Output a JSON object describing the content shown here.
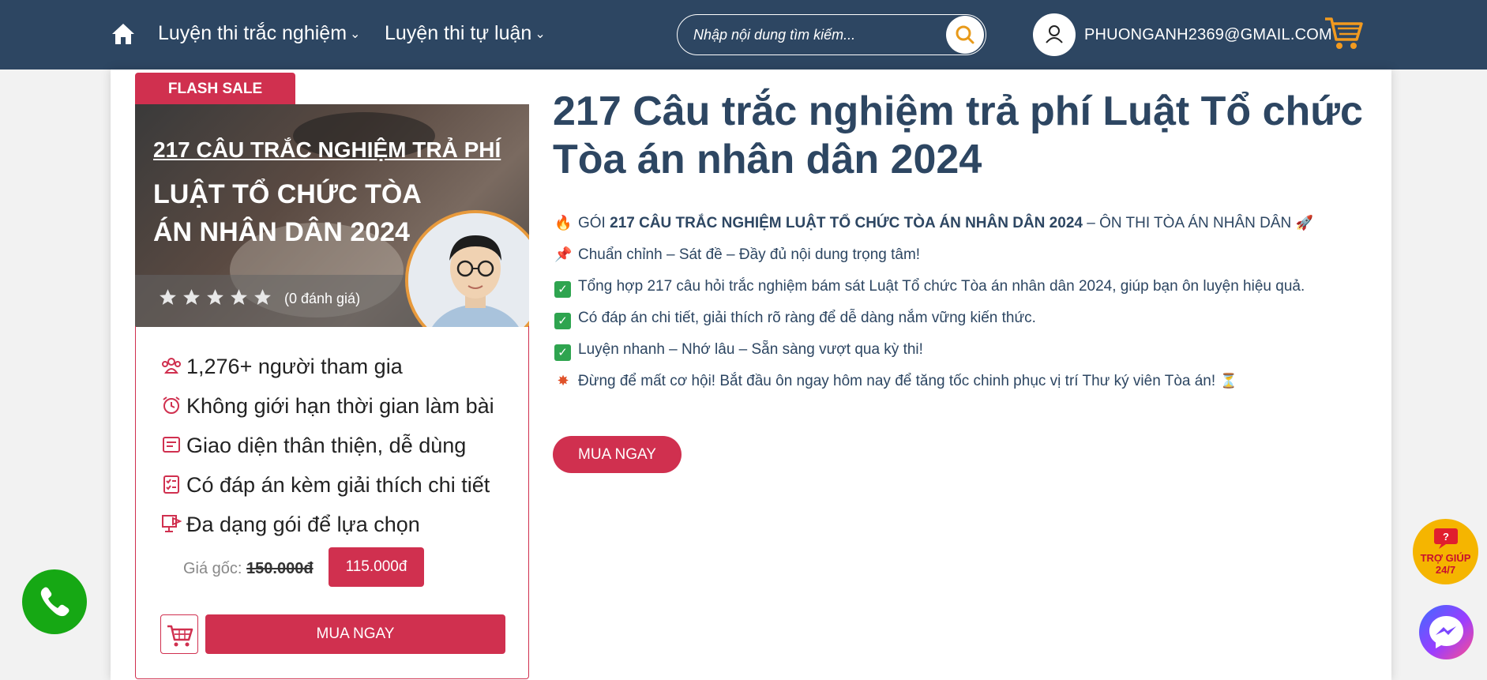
{
  "colors": {
    "header_bg": "#2d4662",
    "accent": "#d0304f",
    "title": "#2d4662",
    "check": "#2ea44f",
    "phone": "#16a814",
    "help": "#f5b500"
  },
  "header": {
    "nav": [
      {
        "label": "Luyện thi trắc nghiệm",
        "icon": "chevron-down-icon"
      },
      {
        "label": "Luyện thi tự luận",
        "icon": "chevron-down-icon"
      }
    ],
    "search_placeholder": "Nhập nội dung tìm kiếm...",
    "user_email": "PHUONGANH2369@GMAIL.COM"
  },
  "product": {
    "flash_sale": "FLASH SALE",
    "banner_title_line1": "217 CÂU TRẮC NGHIỆM TRẢ PHÍ",
    "banner_title_line2": "LUẬT TỔ CHỨC TÒA ÁN NHÂN DÂN 2024",
    "rating_stars": 0,
    "rating_text": "(0 đánh giá)",
    "features": [
      {
        "icon": "users-icon",
        "text": "1,276+ người tham gia"
      },
      {
        "icon": "alarm-clock-icon",
        "text": "Không giới hạn thời gian làm bài"
      },
      {
        "icon": "interface-icon",
        "text": "Giao diện thân thiện, dễ dùng"
      },
      {
        "icon": "checklist-icon",
        "text": "Có đáp án kèm giải thích chi tiết"
      },
      {
        "icon": "presentation-icon",
        "text": "Đa dạng gói để lựa chọn"
      }
    ],
    "price_label": "Giá gốc:",
    "price_old": "150.000đ",
    "price_new": "115.000đ",
    "buy_label": "MUA NGAY"
  },
  "detail": {
    "title": "217 Câu trắc nghiệm trả phí Luật Tổ chức Tòa án nhân dân 2024",
    "line1_prefix": "GÓI ",
    "line1_bold": "217 CÂU TRẮC NGHIỆM LUẬT TỔ CHỨC TÒA ÁN NHÂN DÂN 2024",
    "line1_suffix": " – ÔN THI TÒA ÁN NHÂN DÂN",
    "line2": "Chuẩn chỉnh – Sát đề – Đầy đủ nội dung trọng tâm!",
    "line3": "Tổng hợp 217 câu hỏi trắc nghiệm bám sát Luật Tổ chức Tòa án nhân dân 2024, giúp bạn ôn luyện hiệu quả.",
    "line4": "Có đáp án chi tiết, giải thích rõ ràng để dễ dàng nắm vững kiến thức.",
    "line5": "Luyện nhanh – Nhớ lâu – Sẵn sàng vượt qua kỳ thi!",
    "line6": "Đừng để mất cơ hội! Bắt đầu ôn ngay hôm nay để tăng tốc chinh phục vị trí Thư ký viên Tòa án!",
    "buy_label": "MUA NGAY"
  },
  "floating": {
    "help_line1": "TRỢ GIÚP",
    "help_line2": "24/7"
  }
}
